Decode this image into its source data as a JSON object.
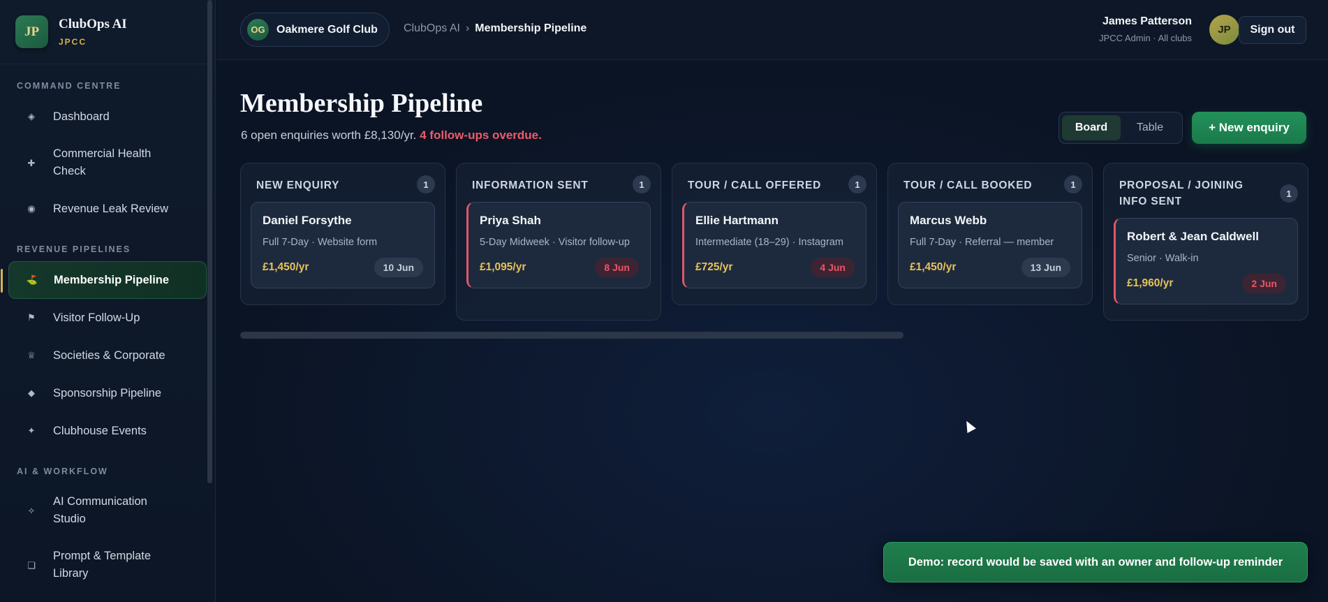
{
  "brand": {
    "logo": "JP",
    "name": "ClubOps AI",
    "sub": "JPCC"
  },
  "sidebar": {
    "sections": [
      {
        "title": "COMMAND CENTRE",
        "items": [
          {
            "label": "Dashboard",
            "icon": "diamond-outline-icon"
          },
          {
            "label": "Commercial Health Check",
            "icon": "plus-icon"
          },
          {
            "label": "Revenue Leak Review",
            "icon": "target-icon"
          }
        ]
      },
      {
        "title": "REVENUE PIPELINES",
        "items": [
          {
            "label": "Membership Pipeline",
            "icon": "golf-flag-icon",
            "active": true
          },
          {
            "label": "Visitor Follow-Up",
            "icon": "flag-icon"
          },
          {
            "label": "Societies & Corporate",
            "icon": "crown-icon"
          },
          {
            "label": "Sponsorship Pipeline",
            "icon": "diamond-icon"
          },
          {
            "label": "Clubhouse Events",
            "icon": "sparkle-icon"
          }
        ]
      },
      {
        "title": "AI & WORKFLOW",
        "items": [
          {
            "label": "AI Communication Studio",
            "icon": "sparkle-outline-icon"
          },
          {
            "label": "Prompt & Template Library",
            "icon": "copy-icon"
          }
        ]
      }
    ]
  },
  "header": {
    "club_avatar": "OG",
    "club_name": "Oakmere Golf Club",
    "breadcrumb_root": "ClubOps AI",
    "breadcrumb_sep": "›",
    "breadcrumb_current": "Membership Pipeline",
    "user_name": "James Patterson",
    "user_role": "JPCC Admin · All clubs",
    "user_initials": "JP",
    "signout_label": "Sign out"
  },
  "page": {
    "title": "Membership Pipeline",
    "subtitle": "6 open enquiries worth £8,130/yr.",
    "overdue": "4 follow-ups overdue.",
    "view_board": "Board",
    "view_table": "Table",
    "new_button": "+ New enquiry"
  },
  "columns": [
    {
      "title": "NEW ENQUIRY",
      "count": "1",
      "cards": [
        {
          "name": "Daniel Forsythe",
          "meta": "Full 7-Day · Website form",
          "value": "£1,450/yr",
          "date": "10 Jun",
          "overdue": false
        }
      ]
    },
    {
      "title": "INFORMATION SENT",
      "count": "1",
      "cards": [
        {
          "name": "Priya Shah",
          "meta": "5-Day Midweek · Visitor follow-up",
          "value": "£1,095/yr",
          "date": "8 Jun",
          "overdue": true
        }
      ]
    },
    {
      "title": "TOUR / CALL OFFERED",
      "count": "1",
      "cards": [
        {
          "name": "Ellie Hartmann",
          "meta": "Intermediate (18–29) · Instagram",
          "value": "£725/yr",
          "date": "4 Jun",
          "overdue": true
        }
      ]
    },
    {
      "title": "TOUR / CALL BOOKED",
      "count": "1",
      "cards": [
        {
          "name": "Marcus Webb",
          "meta": "Full 7-Day · Referral — member",
          "value": "£1,450/yr",
          "date": "13 Jun",
          "overdue": false
        }
      ]
    },
    {
      "title": "PROPOSAL / JOINING INFO SENT",
      "count": "1",
      "cards": [
        {
          "name": "Robert & Jean Caldwell",
          "meta": "Senior · Walk-in",
          "value": "£1,960/yr",
          "date": "2 Jun",
          "overdue": true
        }
      ]
    }
  ],
  "toast": "Demo: record would be saved with an owner and follow-up reminder"
}
